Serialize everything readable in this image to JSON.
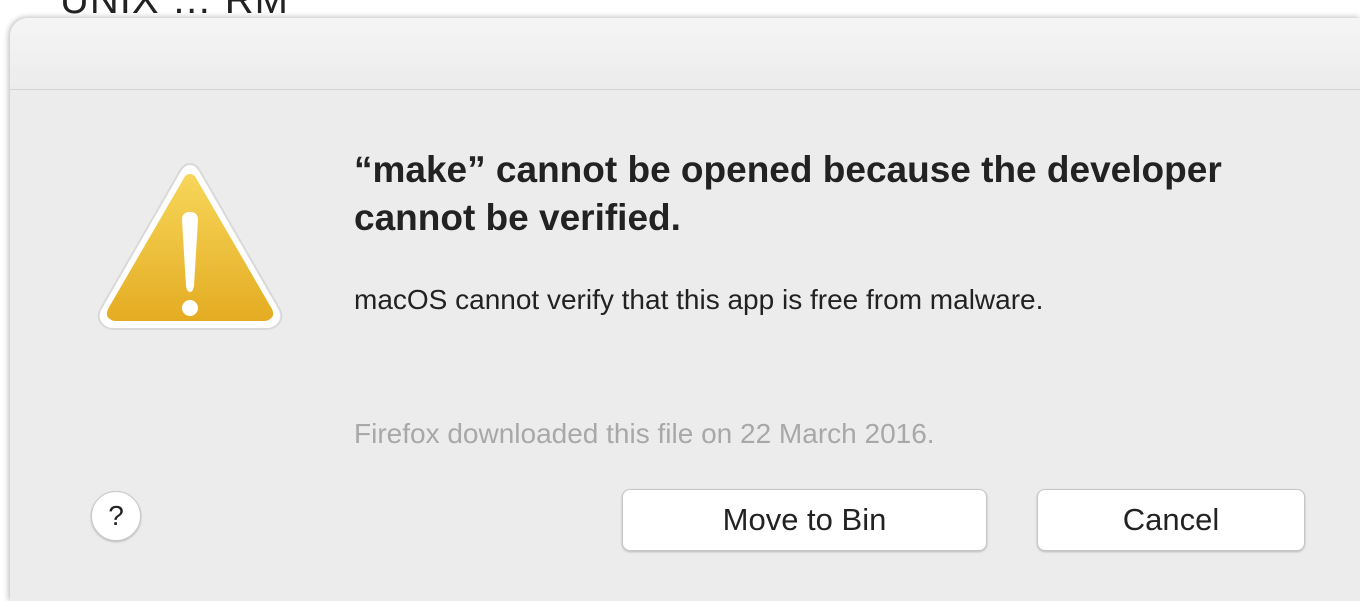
{
  "dialog": {
    "title": "“make” cannot be opened because the developer cannot be verified.",
    "message": "macOS cannot verify that this app is free from malware.",
    "info": "Firefox downloaded this file on 22 March 2016.",
    "help_label": "?",
    "move_to_bin_label": "Move to Bin",
    "cancel_label": "Cancel",
    "icon": "warning-triangle-icon"
  },
  "colors": {
    "dialog_bg": "#ececec",
    "icon_yellow": "#f0be2f",
    "icon_yellow_dark": "#d8a017",
    "info_text": "#a8a8a8"
  }
}
